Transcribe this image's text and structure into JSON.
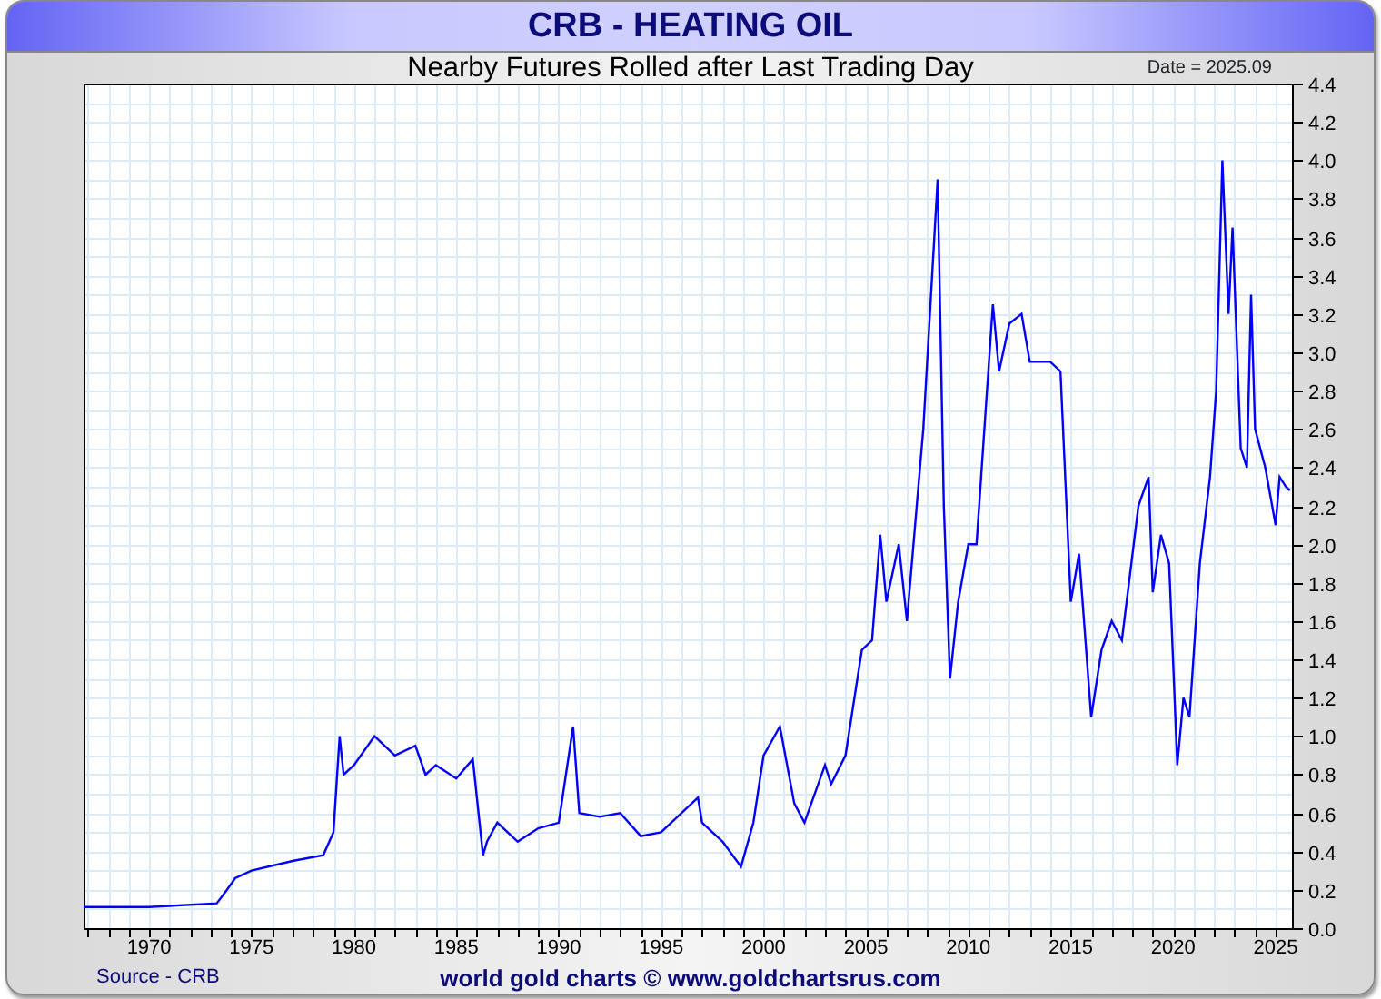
{
  "title": "CRB - HEATING OIL",
  "subtitle": "Nearby Futures Rolled after Last Trading Day",
  "date_label": "Date = 2025.09",
  "chart_data": {
    "type": "line",
    "xlim": [
      1966.8,
      2025.8
    ],
    "ylim": [
      0,
      4.4
    ],
    "xticks": [
      1970,
      1975,
      1980,
      1985,
      1990,
      1995,
      2000,
      2005,
      2010,
      2015,
      2020,
      2025
    ],
    "yticks": [
      {
        "value": 0,
        "label": "0.0"
      },
      {
        "value": 0.2,
        "label": "0.2"
      },
      {
        "value": 0.4,
        "label": "0.4"
      },
      {
        "value": 0.6,
        "label": "0.6"
      },
      {
        "value": 0.8,
        "label": "0.8"
      },
      {
        "value": 1,
        "label": "1.0"
      },
      {
        "value": 1.2,
        "label": "1.2"
      },
      {
        "value": 1.4,
        "label": "1.4"
      },
      {
        "value": 1.6,
        "label": "1.6"
      },
      {
        "value": 1.8,
        "label": "1.8"
      },
      {
        "value": 2,
        "label": "2.0"
      },
      {
        "value": 2.2,
        "label": "2.2"
      },
      {
        "value": 2.4,
        "label": "2.4"
      },
      {
        "value": 2.6,
        "label": "2.6"
      },
      {
        "value": 2.8,
        "label": "2.8"
      },
      {
        "value": 3,
        "label": "3.0"
      },
      {
        "value": 3.2,
        "label": "3.2"
      },
      {
        "value": 3.4,
        "label": "3.4"
      },
      {
        "value": 3.6,
        "label": "3.6"
      },
      {
        "value": 3.8,
        "label": "3.8"
      },
      {
        "value": 4,
        "label": "4.0"
      },
      {
        "value": 4.2,
        "label": "4.2"
      },
      {
        "value": 4.4,
        "label": "4.4"
      }
    ],
    "x": [
      1966.8,
      1970,
      1973.3,
      1973.8,
      1974.2,
      1975,
      1977,
      1978.5,
      1979,
      1979.3,
      1979.5,
      1980,
      1981,
      1982,
      1983,
      1983.5,
      1984,
      1985,
      1985.8,
      1986.3,
      1986.5,
      1987,
      1988,
      1989,
      1990,
      1990.7,
      1991,
      1992,
      1993,
      1994,
      1995,
      1996.8,
      1997,
      1998,
      1998.9,
      1999.5,
      2000,
      2000.8,
      2001.5,
      2002,
      2003,
      2003.3,
      2004,
      2004.8,
      2005.3,
      2005.7,
      2006,
      2006.6,
      2007,
      2007.8,
      2008.5,
      2008.8,
      2009.1,
      2009.5,
      2010,
      2010.4,
      2011.2,
      2011.5,
      2012,
      2012.6,
      2013,
      2014,
      2014.5,
      2015,
      2015.4,
      2016,
      2016.5,
      2017,
      2017.5,
      2018.3,
      2018.8,
      2019,
      2019.4,
      2019.8,
      2020.2,
      2020.5,
      2020.8,
      2021.3,
      2021.8,
      2022.1,
      2022.4,
      2022.7,
      2022.9,
      2023.3,
      2023.6,
      2023.8,
      2024,
      2024.5,
      2025,
      2025.2,
      2025.5,
      2025.7
    ],
    "grid": true,
    "series": [
      {
        "color": "#0000ff",
        "values": [
          0.11,
          0.11,
          0.13,
          0.2,
          0.26,
          0.3,
          0.35,
          0.38,
          0.5,
          1.0,
          0.8,
          0.85,
          1.0,
          0.9,
          0.95,
          0.8,
          0.85,
          0.78,
          0.88,
          0.38,
          0.45,
          0.55,
          0.45,
          0.52,
          0.55,
          1.05,
          0.6,
          0.58,
          0.6,
          0.48,
          0.5,
          0.68,
          0.55,
          0.45,
          0.32,
          0.55,
          0.9,
          1.05,
          0.65,
          0.55,
          0.85,
          0.75,
          0.9,
          1.45,
          1.5,
          2.05,
          1.7,
          2.0,
          1.6,
          2.6,
          3.9,
          2.2,
          1.3,
          1.7,
          2.0,
          2.0,
          3.25,
          2.9,
          3.15,
          3.2,
          2.95,
          2.95,
          2.9,
          1.7,
          1.95,
          1.1,
          1.45,
          1.6,
          1.5,
          2.2,
          2.35,
          1.75,
          2.05,
          1.9,
          0.85,
          1.2,
          1.1,
          1.9,
          2.35,
          2.8,
          4.0,
          3.2,
          3.65,
          2.5,
          2.4,
          3.3,
          2.6,
          2.4,
          2.1,
          2.35,
          2.3,
          2.28
        ]
      }
    ]
  },
  "source": "Source - CRB",
  "credit": "world gold charts © www.goldchartsrus.com"
}
